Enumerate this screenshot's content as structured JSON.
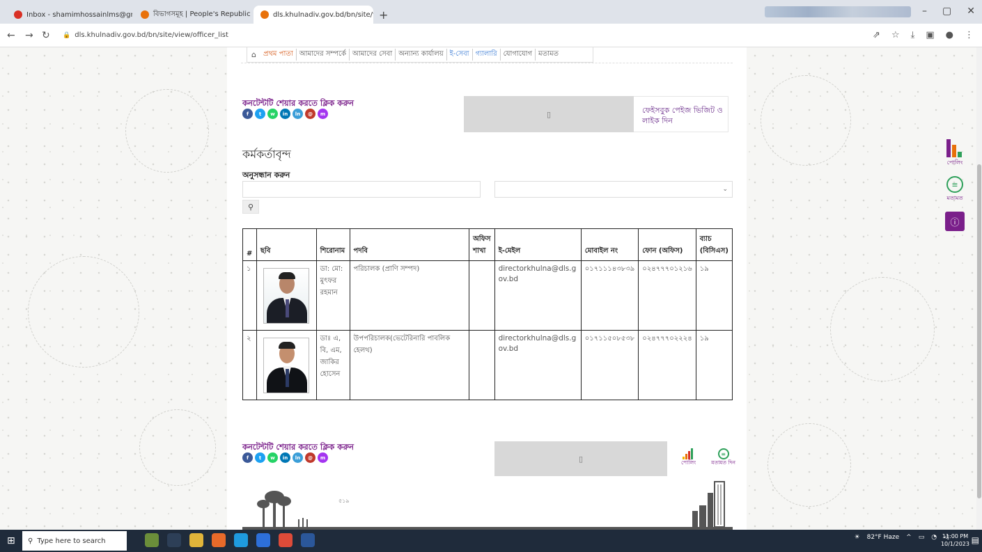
{
  "browser": {
    "tabs": [
      {
        "title": "Inbox - shamimhossainlms@gm",
        "favicon_color": "#d93025",
        "active": false
      },
      {
        "title": "বিভাগসমূহ | People's Republic o",
        "favicon_color": "#e8710a",
        "active": false
      },
      {
        "title": "dls.khulnadiv.gov.bd/bn/site/vi",
        "favicon_color": "#e8710a",
        "active": true
      }
    ],
    "new_tab": "+",
    "url": "dls.khulnadiv.gov.bd/bn/site/view/officer_list"
  },
  "menu": {
    "items": [
      "প্রথম পাতা",
      "আমাদের সম্পর্কে",
      "আমাদের সেবা",
      "অন্যান্য কার্যালয়",
      "ই-সেবা",
      "গ্যালারি",
      "যোগাযোগ",
      "মতামত"
    ]
  },
  "share": {
    "label": "কনটেন্টটি শেয়ার করতে ক্লিক করুন",
    "icons": [
      {
        "name": "facebook",
        "color": "#3b5998",
        "glyph": "f"
      },
      {
        "name": "twitter",
        "color": "#1da1f2",
        "glyph": "t"
      },
      {
        "name": "whatsapp",
        "color": "#25d366",
        "glyph": "w"
      },
      {
        "name": "linkedin",
        "color": "#0077b5",
        "glyph": "in"
      },
      {
        "name": "link",
        "color": "#3b9ed8",
        "glyph": "ln"
      },
      {
        "name": "email",
        "color": "#c0392b",
        "glyph": "@"
      },
      {
        "name": "messenger",
        "color": "#a435f0",
        "glyph": "m"
      }
    ]
  },
  "facebook_box": {
    "text": "ফেইসবুক পেইজ ভিজিট ও লাইক দিন"
  },
  "page": {
    "title": "কর্মকর্তাবৃন্দ",
    "search_label": "অনুসন্ধান করুন",
    "search_placeholder": ""
  },
  "table": {
    "headers": [
      "#",
      "ছবি",
      "শিরোনাম",
      "পদবি",
      "অফিস শাখা",
      "ই-মেইল",
      "মোবাইল নং",
      "ফোন (অফিস)",
      "ব্যাচ (বিসিএস)"
    ],
    "rows": [
      {
        "num": "১",
        "name": "ডা: মো: মুৎফর রহমান",
        "designation": "পরিচালক (প্রাণি সম্পদ)",
        "branch": "",
        "email": "directorkhulna@dls.gov.bd",
        "mobile": "০১৭১১১৪৩৮৩৯",
        "phone": "০২৪৭৭৭০১২১৬",
        "batch": "১৯"
      },
      {
        "num": "২",
        "name": "ডাঃ এ, বি, এম, জাকির হোসেন",
        "designation": "উপপরিচালক(ভেটেরিনারি পাবলিক হেলথ)",
        "branch": "",
        "email": "directorkhulna@dls.gov.bd",
        "mobile": "০১৭১১৫০৮৫৩৮",
        "phone": "০২৪৭৭৭০২২২৪",
        "batch": "১৯"
      }
    ]
  },
  "footer": {
    "poll_label": "পোলিং",
    "feedback_label": "মতামত দিন",
    "skyline_text": "৫১৯"
  },
  "side_widget": {
    "poll_label": "পোলিং",
    "feedback_label": "মতামত"
  },
  "taskbar": {
    "search_placeholder": "Type here to search",
    "weather": "82°F Haze",
    "time": "11:00 PM",
    "date": "10/1/2023"
  },
  "colors": {
    "brand_purple": "#7a1f8a",
    "accent_green": "#2ea05a"
  }
}
